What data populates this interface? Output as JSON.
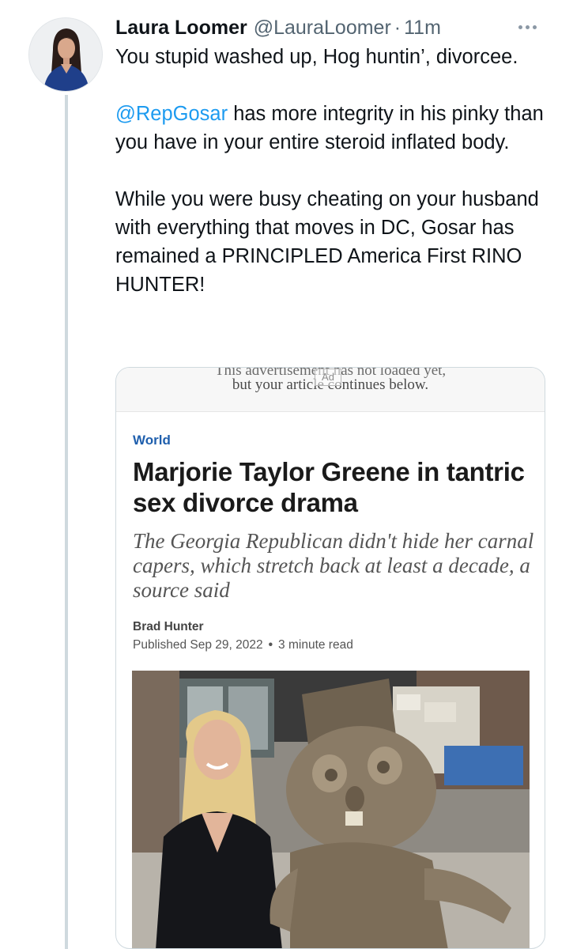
{
  "tweet": {
    "author_name": "Laura Loomer",
    "handle": "@LauraLoomer",
    "separator": "·",
    "time": "11m",
    "line1": "You stupid washed up, Hog huntin’, divorcee.",
    "mention": "@RepGosar",
    "line2_rest": " has more integrity in his pinky than you have in your entire steroid inflated body.",
    "line3": "While you were busy cheating on your husband with everything that moves in DC, Gosar has remained a PRINCIPLED America First RINO HUNTER!"
  },
  "article": {
    "ad_line1": "This advertisement has not loaded yet,",
    "ad_line2": "but your article continues below.",
    "ad_badge": "Ad",
    "section": "World",
    "headline": "Marjorie Taylor Greene in tantric sex divorce drama",
    "deck": "The Georgia Republican didn't hide her carnal capers, which stretch back at least a decade, a source said",
    "author": "Brad Hunter",
    "published": "Published Sep 29, 2022",
    "meta_separator": "•",
    "read_time": "3 minute read"
  },
  "icons": {
    "more": "more-horizontal-icon"
  },
  "colors": {
    "mention": "#1d9bf0",
    "section": "#1f5fad",
    "thread_line": "#cfd9de"
  }
}
